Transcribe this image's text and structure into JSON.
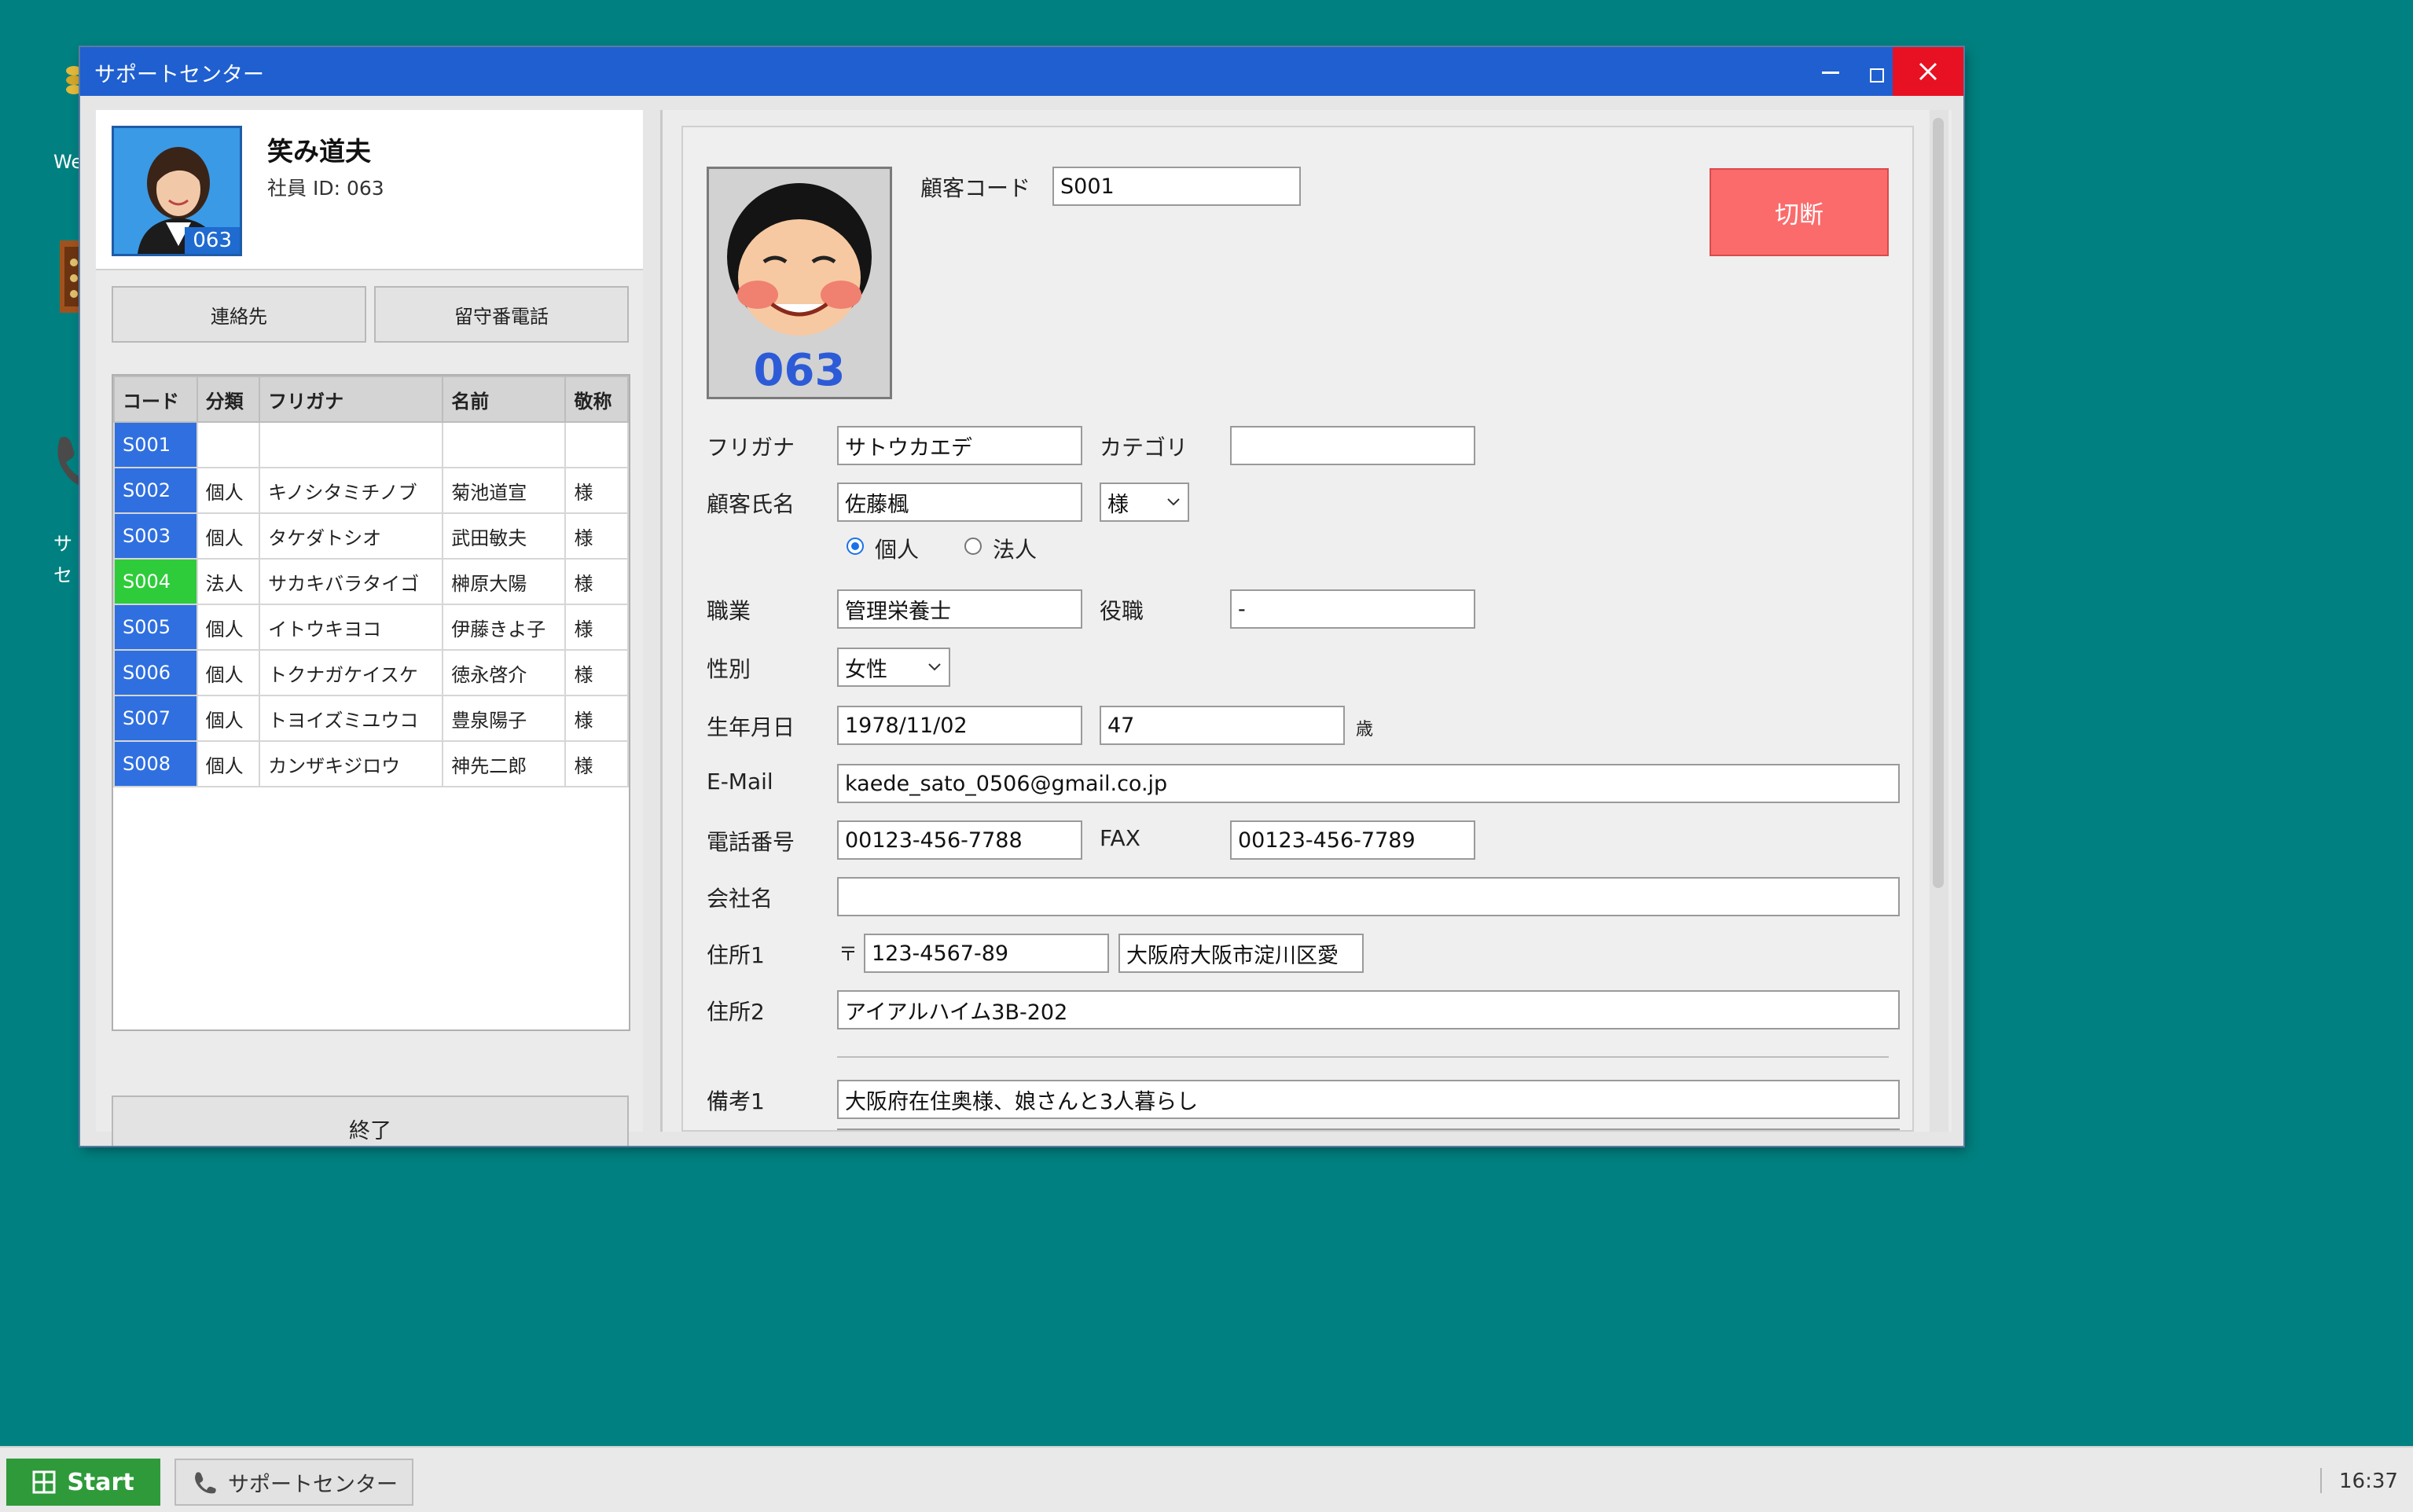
{
  "window": {
    "title": "サポートセンター"
  },
  "desktop": {
    "icon_label_1": "We",
    "icon_label_2": "サ",
    "icon_label_3": "セ"
  },
  "employee": {
    "name": "笑み道夫",
    "id_text": "社員 ID: 063",
    "avatar_badge": "063"
  },
  "left_buttons": {
    "contacts": "連絡先",
    "voicemail": "留守番電話",
    "exit": "終了"
  },
  "customer_table": {
    "headers": [
      "コード",
      "分類",
      "フリガナ",
      "名前",
      "敬称"
    ],
    "rows": [
      {
        "code": "S001",
        "type": "",
        "kana": "",
        "name": "",
        "honorific": ""
      },
      {
        "code": "S002",
        "type": "個人",
        "kana": "キノシタミチノブ",
        "name": "菊池道宣",
        "honorific": "様"
      },
      {
        "code": "S003",
        "type": "個人",
        "kana": "タケダトシオ",
        "name": "武田敏夫",
        "honorific": "様"
      },
      {
        "code": "S004",
        "type": "法人",
        "kana": "サカキバラタイゴ",
        "name": "榊原大陽",
        "honorific": "様"
      },
      {
        "code": "S005",
        "type": "個人",
        "kana": "イトウキヨコ",
        "name": "伊藤きよ子",
        "honorific": "様"
      },
      {
        "code": "S006",
        "type": "個人",
        "kana": "トクナガケイスケ",
        "name": "徳永啓介",
        "honorific": "様"
      },
      {
        "code": "S007",
        "type": "個人",
        "kana": "トヨイズミユウコ",
        "name": "豊泉陽子",
        "honorific": "様"
      },
      {
        "code": "S008",
        "type": "個人",
        "kana": "カンザキジロウ",
        "name": "神先二郎",
        "honorific": "様"
      }
    ]
  },
  "form": {
    "photo_badge": "063",
    "labels": {
      "customer_code": "顧客コード",
      "furigana": "フリガナ",
      "category": "カテゴリ",
      "customer_name": "顧客氏名",
      "personal": "個人",
      "corporate": "法人",
      "occupation": "職業",
      "position": "役職",
      "gender": "性別",
      "birthdate": "生年月日",
      "age_unit": "歳",
      "email": "E-Mail",
      "phone": "電話番号",
      "fax": "FAX",
      "company": "会社名",
      "address1": "住所1",
      "postal_mark": "〒",
      "address2": "住所2",
      "notes1": "備考1"
    },
    "values": {
      "customer_code": "S001",
      "furigana": "サトウカエデ",
      "category": "",
      "customer_name": "佐藤楓",
      "honorific": "様",
      "customer_type": "個人",
      "occupation": "管理栄養士",
      "position": "-",
      "gender": "女性",
      "birthdate": "1978/11/02",
      "age": "47",
      "email": "kaede_sato_0506@gmail.co.jp",
      "phone": "00123-456-7788",
      "fax": "00123-456-7789",
      "company": "",
      "postal_code": "123-4567-89",
      "address1": "大阪府大阪市淀川区愛",
      "address2": "アイアルハイム3B-202",
      "notes1": "大阪府在住奥様、娘さんと3人暮らし"
    },
    "disconnect_label": "切断"
  },
  "taskbar": {
    "start_label": "Start",
    "task_label": "サポートセンター",
    "clock": "16:37"
  },
  "colors": {
    "desktop_bg": "#008080",
    "titlebar": "#1f5fd0",
    "close_btn": "#e81123",
    "code_cell": "#2f6fe0",
    "code_cell_highlight": "#2ecc3a",
    "disconnect": "#fb6b6b",
    "start_btn": "#2f9a3a"
  }
}
